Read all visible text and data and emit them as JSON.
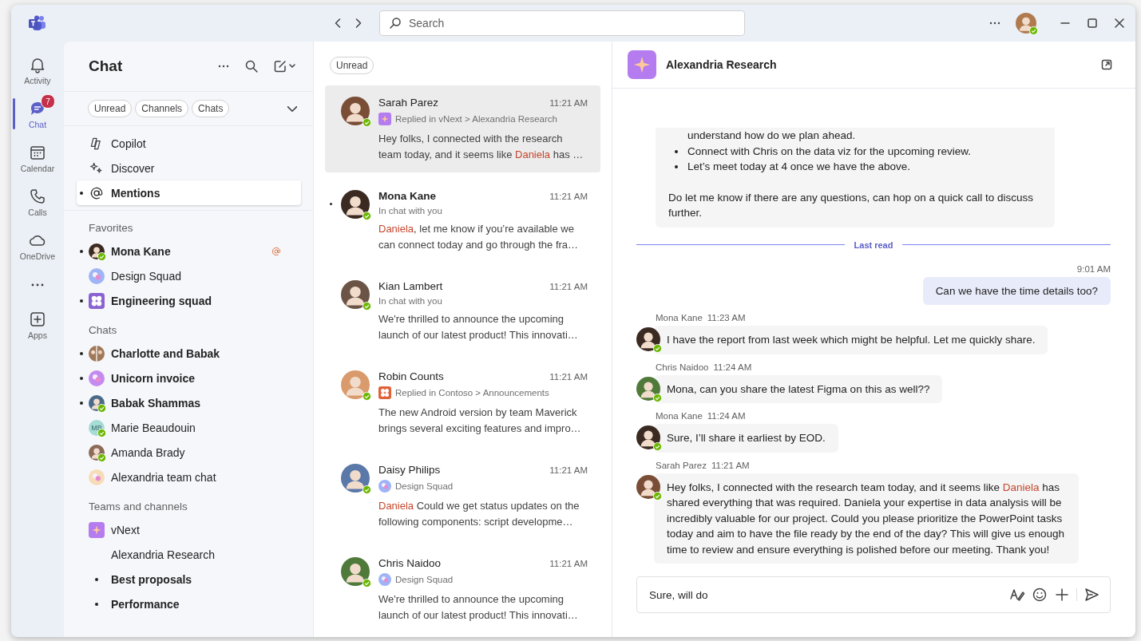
{
  "title_bar": {
    "search": {
      "placeholder": "Search"
    },
    "user": {
      "online": true,
      "avatar": {
        "kind": "person",
        "color": "#b07a4f"
      }
    }
  },
  "rail": [
    {
      "label": "Activity",
      "selected": false
    },
    {
      "label": "Chat",
      "selected": true,
      "badge": "7"
    },
    {
      "label": "Calendar",
      "selected": false
    },
    {
      "label": "Calls",
      "selected": false
    },
    {
      "label": "OneDrive",
      "selected": false
    },
    {
      "kind": "more",
      "selected": false
    },
    {
      "label": "Apps",
      "selected": false
    }
  ],
  "chat_pane": {
    "title": "Chat",
    "filters": [
      {
        "label": "Unread",
        "selected": false
      },
      {
        "label": "Channels",
        "selected": false
      },
      {
        "label": "Chats",
        "selected": false
      }
    ],
    "quick_links": [
      {
        "label": "Copilot",
        "selected": false,
        "unread": false
      },
      {
        "label": "Discover",
        "selected": false,
        "unread": false
      },
      {
        "label": "Mentions",
        "selected": true,
        "unread": true
      }
    ],
    "sections": [
      {
        "heading": "Favorites",
        "items": [
          {
            "name": "Mona Kane",
            "unread": true,
            "online": true,
            "mentioned": true,
            "avatar": {
              "kind": "person",
              "color": "#3b2a22"
            }
          },
          {
            "name": "Design Squad",
            "unread": false,
            "online": false,
            "mentioned": false,
            "avatar": {
              "kind": "group",
              "color": "#9fb4f5"
            }
          },
          {
            "name": "Engineering squad",
            "unread": true,
            "online": false,
            "mentioned": false,
            "avatar": {
              "kind": "apps",
              "color": "#8a63d2"
            }
          }
        ]
      },
      {
        "heading": "Chats",
        "items": [
          {
            "name": "Charlotte and Babak",
            "unread": true,
            "online": false,
            "mentioned": false,
            "avatar": {
              "kind": "pair",
              "color": "#a0785a"
            }
          },
          {
            "name": "Unicorn invoice",
            "unread": true,
            "online": false,
            "mentioned": false,
            "avatar": {
              "kind": "group",
              "color": "#c58af0"
            }
          },
          {
            "name": "Babak Shammas",
            "unread": true,
            "online": true,
            "mentioned": false,
            "avatar": {
              "kind": "person",
              "color": "#4a6a8a"
            }
          },
          {
            "name": "Marie Beaudouin",
            "unread": false,
            "online": true,
            "mentioned": false,
            "avatar": {
              "kind": "initials",
              "initials": "MB",
              "color": "#a6dcd6"
            }
          },
          {
            "name": "Amanda Brady",
            "unread": false,
            "online": true,
            "mentioned": false,
            "avatar": {
              "kind": "person",
              "color": "#8c6a58"
            }
          },
          {
            "name": "Alexandria team chat",
            "unread": false,
            "online": false,
            "mentioned": false,
            "avatar": {
              "kind": "group",
              "color": "#f7dcb8"
            }
          }
        ]
      },
      {
        "heading": "Teams and channels",
        "items": [
          {
            "name": "vNext",
            "unread": false,
            "online": false,
            "mentioned": false,
            "avatar": {
              "kind": "team",
              "color": "#b57cf0"
            },
            "children": [
              {
                "name": "Alexandria Research",
                "unread": false
              },
              {
                "name": "Best proposals",
                "unread": true
              },
              {
                "name": "Performance",
                "unread": true
              }
            ]
          }
        ]
      }
    ]
  },
  "message_list": {
    "filters": [
      {
        "label": "Unread",
        "selected": false
      }
    ],
    "items": [
      {
        "name": "Sarah Parez",
        "time": "11:21 AM",
        "unread": false,
        "selected": true,
        "online": true,
        "avatar": {
          "kind": "person",
          "color": "#7a4e36"
        },
        "context": {
          "text": "Replied in vNext > Alexandria Research",
          "icon": {
            "kind": "team",
            "color": "#b57cf0"
          }
        },
        "preview": [
          {
            "text": "Hey folks, I connected with the research team today, and it seems like ",
            "mention": false
          },
          {
            "text": "Daniela",
            "mention": true
          },
          {
            "text": " has …",
            "mention": false
          }
        ]
      },
      {
        "name": "Mona Kane",
        "time": "11:21 AM",
        "unread": true,
        "selected": false,
        "online": true,
        "avatar": {
          "kind": "person",
          "color": "#3b2a22"
        },
        "context": {
          "text": "In chat with you"
        },
        "preview": [
          {
            "text": "Daniela",
            "mention": true
          },
          {
            "text": ", let me know if you’re available we can connect today and go through the fra…",
            "mention": false
          }
        ]
      },
      {
        "name": "Kian Lambert",
        "time": "11:21 AM",
        "unread": false,
        "selected": false,
        "online": true,
        "avatar": {
          "kind": "person",
          "color": "#6b5446"
        },
        "context": {
          "text": "In chat with you"
        },
        "preview": [
          {
            "text": "We're thrilled to announce the upcoming launch of our latest product! This innovati…",
            "mention": false
          }
        ]
      },
      {
        "name": "Robin Counts",
        "time": "11:21 AM",
        "unread": false,
        "selected": false,
        "online": true,
        "avatar": {
          "kind": "person",
          "color": "#d99a6c"
        },
        "context": {
          "text": "Replied in Contoso > Announcements",
          "icon": {
            "kind": "apps",
            "color": "#e0623a"
          }
        },
        "preview": [
          {
            "text": "The new Android version by team Maverick brings several exciting features and impro…",
            "mention": false
          }
        ]
      },
      {
        "name": "Daisy Philips",
        "time": "11:21 AM",
        "unread": false,
        "selected": false,
        "online": true,
        "avatar": {
          "kind": "person",
          "color": "#5a78a8"
        },
        "context": {
          "text": "Design Squad",
          "icon": {
            "kind": "group",
            "color": "#9fb4f5"
          }
        },
        "preview": [
          {
            "text": "Daniela",
            "mention": true
          },
          {
            "text": " Could we get status updates on the following components: script developme…",
            "mention": false
          }
        ]
      },
      {
        "name": "Chris Naidoo",
        "time": "11:21 AM",
        "unread": false,
        "selected": false,
        "online": true,
        "avatar": {
          "kind": "person",
          "color": "#4f7a3a"
        },
        "context": {
          "text": "Design Squad",
          "icon": {
            "kind": "group",
            "color": "#9fb4f5"
          }
        },
        "preview": [
          {
            "text": "We're thrilled to announce the upcoming launch of our latest product! This innovati…",
            "mention": false
          }
        ]
      }
    ]
  },
  "conversation": {
    "title": "Alexandria Research",
    "messages": [
      {
        "kind": "other",
        "bullets": [
          {
            "text": "understand how do we plan ahead.",
            "marker": false
          },
          {
            "text": "Connect with Chris on the data viz for the upcoming review.",
            "marker": true
          },
          {
            "text": "Let’s meet today at 4 once we have the above.",
            "marker": true
          }
        ],
        "text": [
          {
            "text": "Do let me know if there are any questions, can hop on a quick call to discuss further.",
            "mention": false
          }
        ]
      },
      {
        "kind": "divider",
        "label": "Last read"
      },
      {
        "kind": "mine",
        "time": "9:01 AM",
        "text": [
          {
            "text": "Can we have the time details too?",
            "mention": false
          }
        ]
      },
      {
        "kind": "other",
        "author": "Mona Kane",
        "time": "11:23 AM",
        "online": true,
        "avatar": {
          "kind": "person",
          "color": "#3b2a22"
        },
        "text": [
          {
            "text": "I have the report from last week which might be helpful. Let me quickly share.",
            "mention": false
          }
        ]
      },
      {
        "kind": "other",
        "author": "Chris Naidoo",
        "time": "11:24 AM",
        "online": true,
        "avatar": {
          "kind": "person",
          "color": "#4f7a3a"
        },
        "text": [
          {
            "text": "Mona, can you share the latest Figma on this as well??",
            "mention": false
          }
        ]
      },
      {
        "kind": "other",
        "author": "Mona Kane",
        "time": "11:24 AM",
        "online": true,
        "avatar": {
          "kind": "person",
          "color": "#3b2a22"
        },
        "text": [
          {
            "text": "Sure, I’ll share it earliest by EOD.",
            "mention": false
          }
        ]
      },
      {
        "kind": "other",
        "author": "Sarah Parez",
        "time": "11:21 AM",
        "online": true,
        "avatar": {
          "kind": "person",
          "color": "#7a4e36"
        },
        "text": [
          {
            "text": "Hey folks, I connected with the research team today, and it seems like ",
            "mention": false
          },
          {
            "text": "Daniela",
            "mention": true
          },
          {
            "text": " has shared everything that was required. Daniela your expertise in data analysis will be incredibly valuable for our project. Could you please prioritize the PowerPoint tasks today and aim to have the file ready by the end of the day? This will give us enough time to review and ensure everything is polished before our meeting. Thank you!",
            "mention": false
          }
        ]
      }
    ],
    "composer": {
      "value": "Sure, will do"
    }
  }
}
